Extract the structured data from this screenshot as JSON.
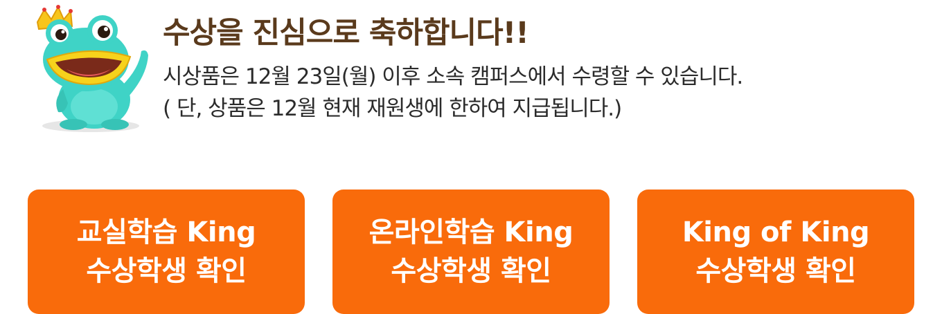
{
  "notice": {
    "headline": "수상을 진심으로 축하합니다!!",
    "line1": "시상품은 12월 23일(월) 이후 소속 캠퍼스에서 수령할 수 있습니다.",
    "line2": "( 단, 상품은 12월 현재 재원생에 한하여  지급됩니다.)"
  },
  "buttons": [
    {
      "line1": "교실학습 King",
      "line2": "수상학생 확인"
    },
    {
      "line1": "온라인학습 King",
      "line2": "수상학생 확인"
    },
    {
      "line1": "King of King",
      "line2": "수상학생 확인"
    }
  ],
  "colors": {
    "headline": "#5a3a1c",
    "button_bg": "#f96b0b",
    "button_text": "#ffffff",
    "mascot_body": "#3fd3c6",
    "mascot_mouth": "#f7d21c",
    "crown": "#f7c51c"
  },
  "icons": {
    "mascot": "frog-mascot-with-crown"
  }
}
